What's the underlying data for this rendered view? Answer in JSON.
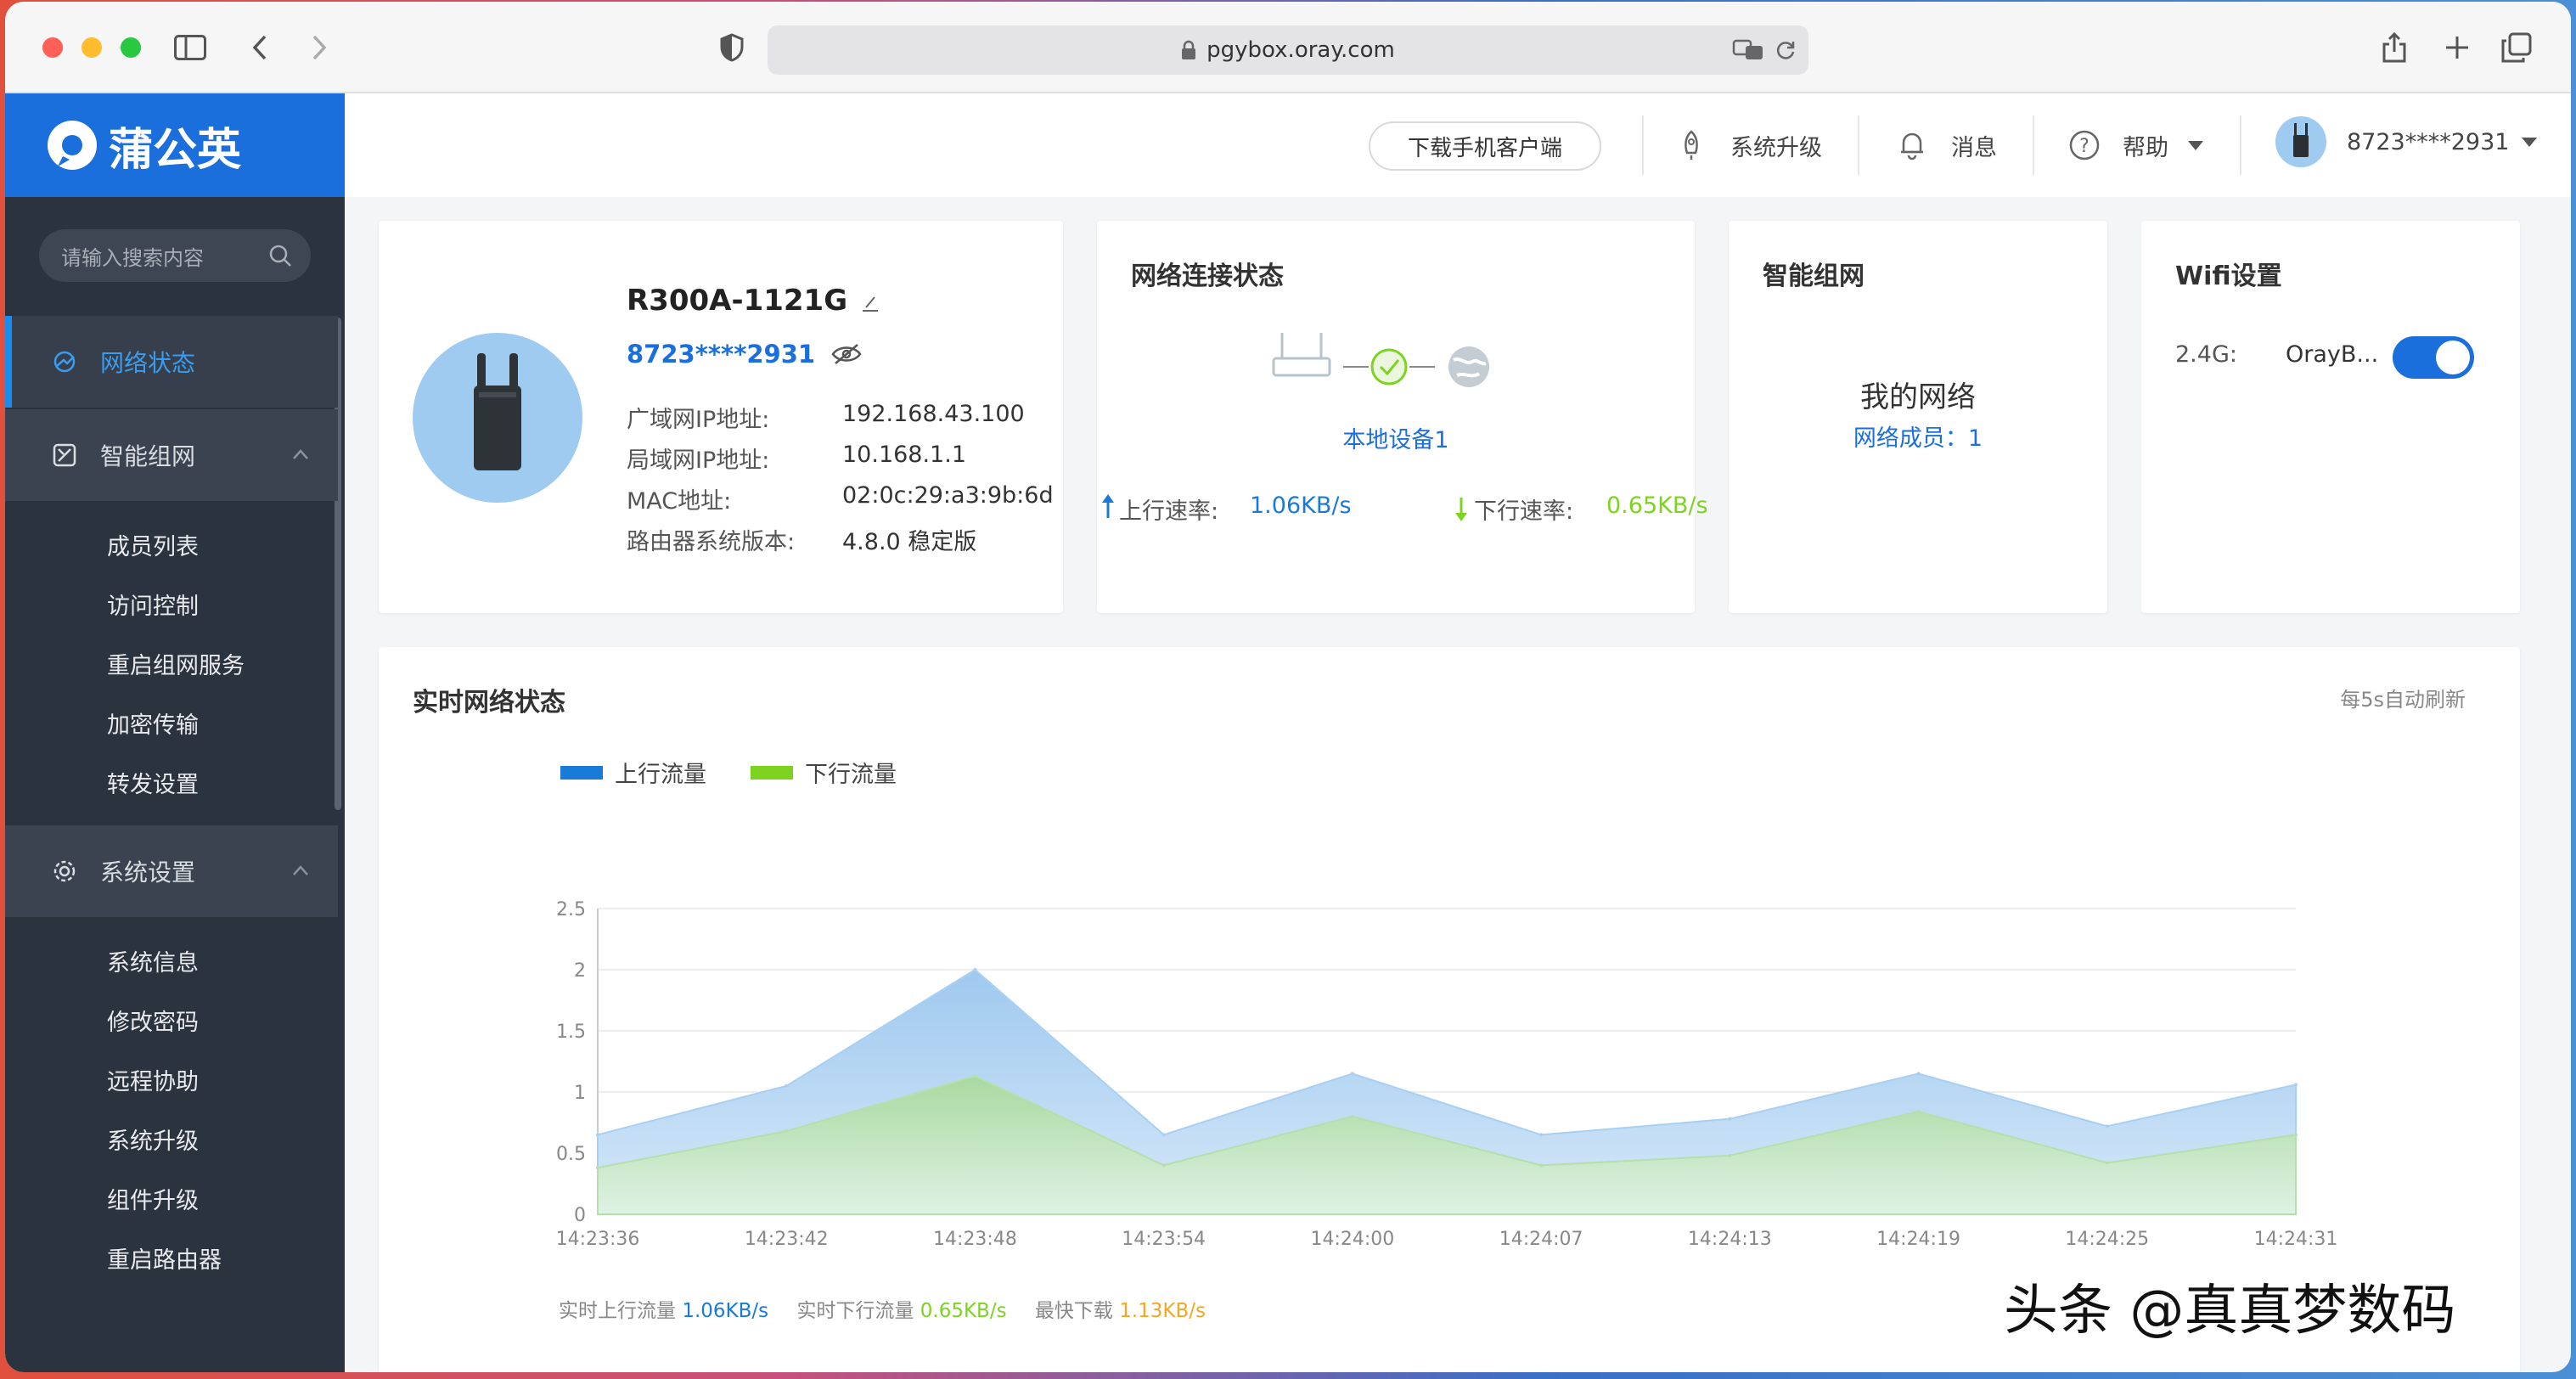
{
  "browser": {
    "url": "pgybox.oray.com"
  },
  "sidebar": {
    "brand": "蒲公英",
    "search_placeholder": "请输入搜索内容",
    "menu": {
      "network_status": "网络状态",
      "smart_network": "智能组网",
      "system_settings": "系统设置"
    },
    "smart_network_items": [
      "成员列表",
      "访问控制",
      "重启组网服务",
      "加密传输",
      "转发设置"
    ],
    "system_items": [
      "系统信息",
      "修改密码",
      "远程协助",
      "系统升级",
      "组件升级",
      "重启路由器"
    ]
  },
  "topnav": {
    "download_app": "下载手机客户端",
    "system_upgrade": "系统升级",
    "messages": "消息",
    "help": "帮助",
    "account": "8723****2931"
  },
  "device": {
    "name": "R300A-1121G",
    "sn": "8723****2931",
    "wan_label": "广域网IP地址:",
    "wan_value": "192.168.43.100",
    "lan_label": "局域网IP地址:",
    "lan_value": "10.168.1.1",
    "mac_label": "MAC地址:",
    "mac_value": "02:0c:29:a3:9b:6d",
    "fw_label": "路由器系统版本:",
    "fw_value": "4.8.0 稳定版"
  },
  "connection": {
    "title": "网络连接状态",
    "local_device": "本地设备1",
    "up_label": "上行速率:",
    "up_value": "1.06KB/s",
    "down_label": "下行速率:",
    "down_value": "0.65KB/s"
  },
  "smartnet": {
    "title": "智能组网",
    "my_network": "我的网络",
    "members": "网络成员：1"
  },
  "wifi": {
    "title": "Wifi设置",
    "band": "2.4G:",
    "ssid": "OrayB...",
    "enabled": true
  },
  "realtime": {
    "title": "实时网络状态",
    "refresh": "每5s自动刷新",
    "legend_up": "上行流量",
    "legend_down": "下行流量",
    "footer_up_label": "实时上行流量",
    "footer_up_value": "1.06KB/s",
    "footer_down_label": "实时下行流量",
    "footer_down_value": "0.65KB/s",
    "footer_max_label": "最快下载",
    "footer_max_value": "1.13KB/s"
  },
  "colors": {
    "brand_blue": "#1a6fdc",
    "up_series": "#1a7ad8",
    "down_series": "#7ed321",
    "max_value": "#f5a623"
  },
  "chart_data": {
    "type": "area",
    "x": [
      "14:23:36",
      "14:23:42",
      "14:23:48",
      "14:23:54",
      "14:24:00",
      "14:24:07",
      "14:24:13",
      "14:24:19",
      "14:24:25",
      "14:24:31"
    ],
    "ylim": [
      0,
      2.5
    ],
    "yticks": [
      "0",
      "0.5",
      "1",
      "1.5",
      "2",
      "2.5"
    ],
    "series": [
      {
        "name": "上行流量",
        "values": [
          0.65,
          1.05,
          2.0,
          0.65,
          1.15,
          0.65,
          0.78,
          1.15,
          0.72,
          1.06
        ]
      },
      {
        "name": "下行流量",
        "values": [
          0.38,
          0.68,
          1.13,
          0.4,
          0.8,
          0.4,
          0.48,
          0.84,
          0.42,
          0.65
        ]
      }
    ],
    "grid": true,
    "legend": "top-left"
  },
  "watermark": "头条 @真真梦数码"
}
